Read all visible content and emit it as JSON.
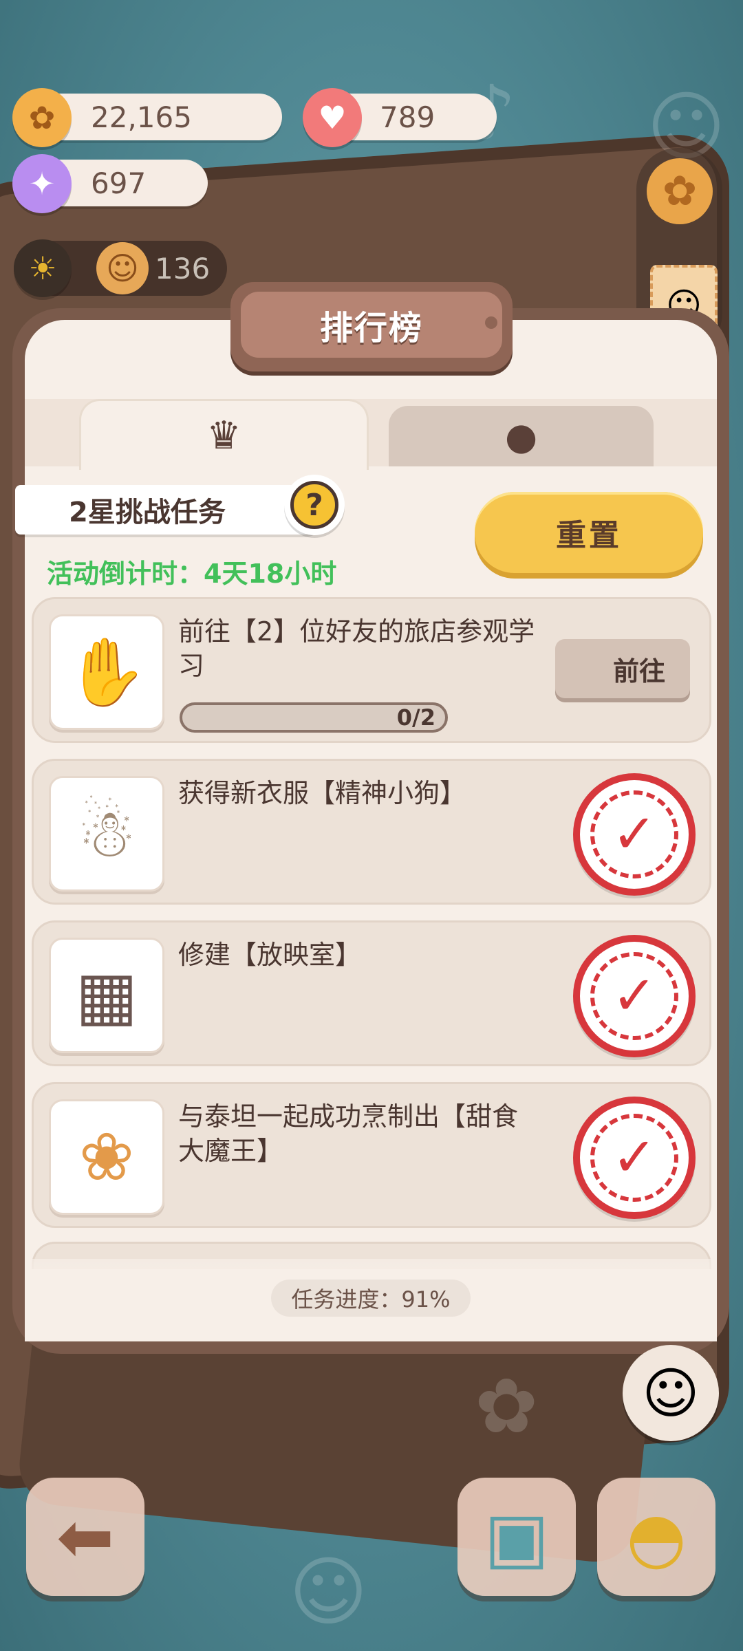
{
  "resources": {
    "cookies": "22,165",
    "gems": "789",
    "candy": "697",
    "staff_count": "136"
  },
  "panel": {
    "title": "排行榜",
    "tabs": [
      {
        "name": "trophy",
        "icon": "trophy-icon",
        "active": true
      },
      {
        "name": "cookie",
        "icon": "cookie-icon",
        "active": false
      }
    ],
    "challenge_label": "2星挑战任务",
    "help_symbol": "?",
    "countdown": "活动倒计时：4天18小时",
    "reset_button": "重置",
    "tasks": [
      {
        "text": "前往【2】位好友的旅店参观学习",
        "progress": "0/2",
        "progress_value": 0,
        "action": "前往",
        "done": false
      },
      {
        "text": "获得新衣服【精神小狗】",
        "done": true
      },
      {
        "text": "修建【放映室】",
        "done": true
      },
      {
        "text": "与泰坦一起成功烹制出【甜食大魔王】",
        "done": true
      }
    ],
    "overall_progress": "任务进度：91%"
  },
  "colors": {
    "accent_yellow": "#f6c64e",
    "stamp_red": "#d7373c",
    "countdown_green": "#42c05a",
    "panel_bg": "#f7efe8"
  }
}
